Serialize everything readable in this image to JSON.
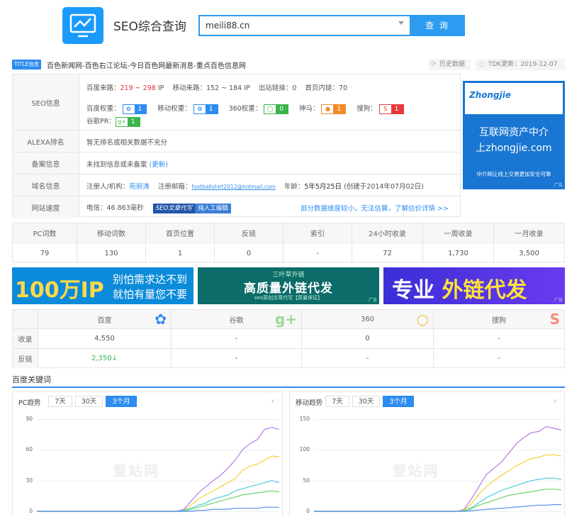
{
  "header": {
    "logo_icon": "chart-monitor-icon",
    "title": "SEO综合查询",
    "search_value": "meili88.cn",
    "search_button": "查 询"
  },
  "title_bar": {
    "tag": "TITLE信息",
    "site_title": "百色新闻网-百色右江论坛-今日百色网最新消息-重点百色信息网",
    "history_btn": "历史数据",
    "tdk_update": "TDK更新：2019-12-07"
  },
  "seo_info": {
    "label": "SEO信息",
    "baidu_traffic_label": "百度来路：",
    "baidu_traffic_value": "219 ~ 298",
    "baidu_traffic_unit": "IP",
    "mobile_traffic_label": "移动来路：",
    "mobile_traffic_value": "152 ~ 184",
    "mobile_traffic_unit": "IP",
    "outlinks_label": "出站链接：",
    "outlinks_value": "0",
    "homepage_links_label": "首页内链：",
    "homepage_links_value": "70",
    "baidu_weight_label": "百度权重：",
    "baidu_weight": "1",
    "mobile_weight_label": "移动权重：",
    "mobile_weight": "1",
    "w360_label": "360权重：",
    "w360": "0",
    "shenma_label": "神马：",
    "shenma": "1",
    "sogou_label": "搜狗：",
    "sogou": "1",
    "google_pr_label": "谷歌PR：",
    "google_pr": "1"
  },
  "alexa": {
    "label": "ALEXA排名",
    "value": "暂无排名或相关数据不充分"
  },
  "icp": {
    "label": "备案信息",
    "value": "未找到信息或未备案",
    "update_link": "(更新)"
  },
  "domain": {
    "label": "域名信息",
    "registrant_label": "注册人/机构：",
    "registrant": "苑丽涛",
    "email_label": "注册邮箱：",
    "email": "footballshirt2012@hotmail.com",
    "age_label": "年龄：",
    "age": "5年5月25日",
    "created": "(创建于2014年07月02日)"
  },
  "speed": {
    "label": "网站速度",
    "value": "电信：46.863毫秒",
    "tag_left": "SEO文章代写",
    "tag_right": "纯人工编辑",
    "note": "部分数据维度较小，无法估算，了解估价详情 >>"
  },
  "ad_right": {
    "brand": "Zhongjie",
    "line1": "互联网资产中介",
    "line2": "上zhongjie.com",
    "line3": "中介网让线上交易更加安全可靠",
    "ad_mark": "广告"
  },
  "stats": {
    "headers": [
      "PC词数",
      "移动词数",
      "首页位置",
      "反链",
      "索引",
      "24小时收录",
      "一周收录",
      "一月收录"
    ],
    "values": [
      "79",
      "130",
      "1",
      "0",
      "-",
      "72",
      "1,730",
      "3,500"
    ]
  },
  "banners": {
    "b1_big": "100万IP",
    "b1_line1": "别怕需求达不到",
    "b1_line2": "就怕有量您不要",
    "b2_top": "三叶草外链",
    "b2_mid": "高质量外链代发",
    "b2_bottom": "seo原创文章代写【质量保证】",
    "b3_left": "专业",
    "b3_right": "外链代发",
    "ad_mark": "广告"
  },
  "engines": {
    "headers": [
      "百度",
      "谷歌",
      "360",
      "搜狗"
    ],
    "row1_label": "收录",
    "row1": [
      "4,550",
      "-",
      "0",
      "-"
    ],
    "row2_label": "反链",
    "row2": [
      "2,350",
      "-",
      "-",
      "-"
    ],
    "row2_trend": "down"
  },
  "keywords": {
    "title": "百度关键词",
    "pc": {
      "label": "PC趋势",
      "tabs": [
        "7天",
        "30天",
        "3个月"
      ],
      "active_tab": 2,
      "yticks": [
        "90",
        "60",
        "30",
        "0"
      ]
    },
    "mobile": {
      "label": "移动趋势",
      "tabs": [
        "7天",
        "30天",
        "3个月"
      ],
      "active_tab": 2,
      "yticks": [
        "150",
        "100",
        "50",
        "0"
      ]
    },
    "watermark": "爱站网"
  },
  "chart_data": [
    {
      "type": "line",
      "ylim": [
        0,
        90
      ],
      "series": [
        {
          "color": "#b57be6",
          "values": [
            0,
            0,
            0,
            0,
            0,
            0,
            0,
            0,
            0,
            0,
            0,
            0,
            0,
            0,
            0,
            0,
            0,
            0,
            0,
            0,
            2,
            10,
            18,
            24,
            30,
            35,
            42,
            50,
            60,
            66,
            70,
            80,
            82,
            80
          ]
        },
        {
          "color": "#f5d033",
          "values": [
            0,
            0,
            0,
            0,
            0,
            0,
            0,
            0,
            0,
            0,
            0,
            0,
            0,
            0,
            0,
            0,
            0,
            0,
            0,
            0,
            1,
            6,
            12,
            16,
            20,
            24,
            28,
            32,
            40,
            44,
            46,
            50,
            54,
            53
          ]
        },
        {
          "color": "#4ecdd8",
          "values": [
            0,
            0,
            0,
            0,
            0,
            0,
            0,
            0,
            0,
            0,
            0,
            0,
            0,
            0,
            0,
            0,
            0,
            0,
            0,
            0,
            1,
            3,
            6,
            8,
            12,
            14,
            16,
            20,
            22,
            24,
            26,
            28,
            30,
            28
          ]
        },
        {
          "color": "#6fd36a",
          "values": [
            0,
            0,
            0,
            0,
            0,
            0,
            0,
            0,
            0,
            0,
            0,
            0,
            0,
            0,
            0,
            0,
            0,
            0,
            0,
            0,
            0,
            2,
            4,
            6,
            8,
            10,
            12,
            14,
            16,
            17,
            18,
            19,
            20,
            19
          ]
        },
        {
          "color": "#5a8dee",
          "values": [
            0,
            0,
            0,
            0,
            0,
            0,
            0,
            0,
            0,
            0,
            0,
            0,
            0,
            0,
            0,
            0,
            0,
            0,
            0,
            0,
            0,
            0,
            1,
            1,
            2,
            2,
            2,
            3,
            3,
            3,
            3,
            4,
            4,
            4
          ]
        }
      ]
    },
    {
      "type": "line",
      "ylim": [
        0,
        150
      ],
      "series": [
        {
          "color": "#b57be6",
          "values": [
            0,
            0,
            0,
            0,
            0,
            0,
            0,
            0,
            0,
            0,
            0,
            0,
            0,
            0,
            0,
            0,
            0,
            0,
            0,
            0,
            3,
            20,
            40,
            60,
            70,
            80,
            95,
            110,
            120,
            128,
            130,
            138,
            135,
            132
          ]
        },
        {
          "color": "#f5d033",
          "values": [
            0,
            0,
            0,
            0,
            0,
            0,
            0,
            0,
            0,
            0,
            0,
            0,
            0,
            0,
            0,
            0,
            0,
            0,
            0,
            0,
            2,
            12,
            28,
            40,
            50,
            58,
            66,
            74,
            80,
            86,
            88,
            92,
            92,
            90
          ]
        },
        {
          "color": "#4ecdd8",
          "values": [
            0,
            0,
            0,
            0,
            0,
            0,
            0,
            0,
            0,
            0,
            0,
            0,
            0,
            0,
            0,
            0,
            0,
            0,
            0,
            0,
            1,
            6,
            14,
            22,
            28,
            34,
            38,
            42,
            46,
            50,
            52,
            54,
            54,
            52
          ]
        },
        {
          "color": "#6fd36a",
          "values": [
            0,
            0,
            0,
            0,
            0,
            0,
            0,
            0,
            0,
            0,
            0,
            0,
            0,
            0,
            0,
            0,
            0,
            0,
            0,
            0,
            1,
            4,
            10,
            14,
            18,
            22,
            26,
            28,
            30,
            32,
            34,
            36,
            36,
            35
          ]
        },
        {
          "color": "#5a8dee",
          "values": [
            0,
            0,
            0,
            0,
            0,
            0,
            0,
            0,
            0,
            0,
            0,
            0,
            0,
            0,
            0,
            0,
            0,
            0,
            0,
            0,
            0,
            1,
            2,
            3,
            4,
            5,
            6,
            7,
            8,
            9,
            10,
            10,
            11,
            11
          ]
        }
      ]
    }
  ]
}
